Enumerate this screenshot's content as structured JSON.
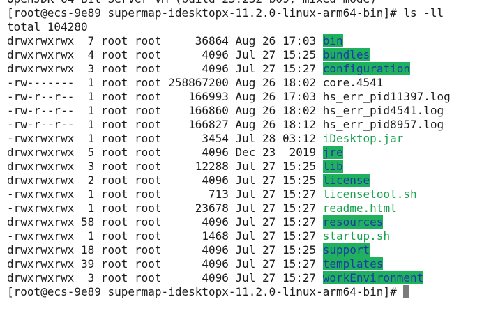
{
  "terminal": {
    "header_line": "OpenJDK 64-Bit Server VM (build 25.232-b09, mixed mode)",
    "command_prompt": "[root@ecs-9e89 supermap-idesktopx-11.2.0-linux-arm64-bin]# ",
    "command": "ls -ll",
    "total": "total 104280",
    "entries": [
      {
        "prefix": "drwxrwxrwx  7 root root     36864 Aug 26 17:03 ",
        "name": "bin",
        "type": "dir"
      },
      {
        "prefix": "drwxrwxrwx  4 root root      4096 Jul 27 15:25 ",
        "name": "bundles",
        "type": "dir"
      },
      {
        "prefix": "drwxrwxrwx  3 root root      4096 Jul 27 15:27 ",
        "name": "configuration",
        "type": "dir"
      },
      {
        "prefix": "-rw-------  1 root root 258867200 Aug 26 18:02 ",
        "name": "core.4541",
        "type": "file"
      },
      {
        "prefix": "-rw-r--r--  1 root root    166993 Aug 26 17:03 ",
        "name": "hs_err_pid11397.log",
        "type": "file"
      },
      {
        "prefix": "-rw-r--r--  1 root root    166860 Aug 26 18:02 ",
        "name": "hs_err_pid4541.log",
        "type": "file"
      },
      {
        "prefix": "-rw-r--r--  1 root root    166827 Aug 26 18:12 ",
        "name": "hs_err_pid8957.log",
        "type": "file"
      },
      {
        "prefix": "-rwxrwxrwx  1 root root      3454 Jul 28 03:12 ",
        "name": "iDesktop.jar",
        "type": "exe"
      },
      {
        "prefix": "drwxrwxrwx  5 root root      4096 Dec 23  2019 ",
        "name": "jre",
        "type": "dir"
      },
      {
        "prefix": "drwxrwxrwx  3 root root     12288 Jul 27 15:25 ",
        "name": "lib",
        "type": "dir"
      },
      {
        "prefix": "drwxrwxrwx  2 root root      4096 Jul 27 15:25 ",
        "name": "license",
        "type": "dir"
      },
      {
        "prefix": "-rwxrwxrwx  1 root root       713 Jul 27 15:27 ",
        "name": "licensetool.sh",
        "type": "exe"
      },
      {
        "prefix": "-rwxrwxrwx  1 root root     23678 Jul 27 15:27 ",
        "name": "readme.html",
        "type": "exe"
      },
      {
        "prefix": "drwxrwxrwx 58 root root      4096 Jul 27 15:27 ",
        "name": "resources",
        "type": "dir"
      },
      {
        "prefix": "-rwxrwxrwx  1 root root      1468 Jul 27 15:27 ",
        "name": "startup.sh",
        "type": "exe"
      },
      {
        "prefix": "drwxrwxrwx 18 root root      4096 Jul 27 15:25 ",
        "name": "support",
        "type": "dir"
      },
      {
        "prefix": "drwxrwxrwx 39 root root      4096 Jul 27 15:27 ",
        "name": "templates",
        "type": "dir"
      },
      {
        "prefix": "drwxrwxrwx  3 root root      4096 Jul 27 15:27 ",
        "name": "workEnvironment",
        "type": "dir"
      }
    ],
    "final_prompt": "[root@ecs-9e89 supermap-idesktopx-11.2.0-linux-arm64-bin]# "
  },
  "colors": {
    "background": "#ffffff",
    "text": "#1c1c1c",
    "directory_background": "#1fb15d",
    "directory_text": "#1e3aa8",
    "executable_text": "#1aa14f",
    "cursor": "#7b7b7b"
  }
}
